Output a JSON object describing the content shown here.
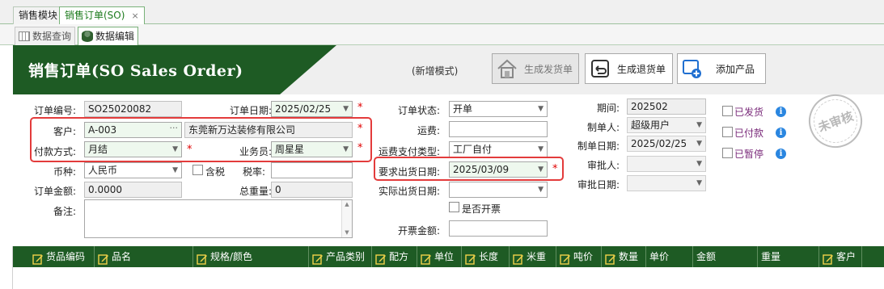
{
  "tabs": [
    {
      "label": "销售模块"
    },
    {
      "label": "销售订单(SO)",
      "close": "×"
    }
  ],
  "subtabs": [
    {
      "label": "数据查询"
    },
    {
      "label": "数据编辑"
    }
  ],
  "header": {
    "title": "销售订单(SO Sales Order)",
    "mode": "(新增模式)",
    "buttons": {
      "generate_shipment": "生成发货单",
      "generate_return": "生成退货单",
      "add_product": "添加产品"
    }
  },
  "form": {
    "order_no": {
      "label": "订单编号:",
      "value": "SO25020082"
    },
    "order_date": {
      "label": "订单日期:",
      "value": "2025/02/25"
    },
    "customer": {
      "label": "客户:",
      "code": "A-003",
      "name": "东莞新万达装修有限公司"
    },
    "payment": {
      "label": "付款方式:",
      "value": "月结"
    },
    "salesman": {
      "label": "业务员:",
      "value": "周星星"
    },
    "currency": {
      "label": "币种:",
      "value": "人民币"
    },
    "tax_included": {
      "label": "含税"
    },
    "tax_rate": {
      "label": "税率:",
      "value": ""
    },
    "order_amount": {
      "label": "订单金额:",
      "value": "0.0000"
    },
    "total_weight": {
      "label": "总重量:",
      "value": "0"
    },
    "remark": {
      "label": "备注:",
      "value": ""
    },
    "order_status": {
      "label": "订单状态:",
      "value": "开单"
    },
    "freight": {
      "label": "运费:",
      "value": ""
    },
    "freight_payment_type": {
      "label": "运费支付类型:",
      "value": "工厂自付"
    },
    "required_ship_date": {
      "label": "要求出货日期:",
      "value": "2025/03/09"
    },
    "actual_ship_date": {
      "label": "实际出货日期:",
      "value": ""
    },
    "invoice": {
      "label": "是否开票"
    },
    "invoice_amount": {
      "label": "开票金额:",
      "value": ""
    },
    "period": {
      "label": "期间:",
      "value": "202502"
    },
    "creator": {
      "label": "制单人:",
      "value": "超级用户"
    },
    "create_date": {
      "label": "制单日期:",
      "value": "2025/02/25"
    },
    "approver": {
      "label": "审批人:",
      "value": ""
    },
    "approve_date": {
      "label": "审批日期:",
      "value": ""
    },
    "flags": [
      {
        "label": "已发货"
      },
      {
        "label": "已付款"
      },
      {
        "label": "已暂停"
      }
    ],
    "stamp": "未审核"
  },
  "table": {
    "columns": [
      {
        "label": "货品编码",
        "editable": true
      },
      {
        "label": "品名",
        "editable": true
      },
      {
        "label": "规格/颜色",
        "editable": true
      },
      {
        "label": "产品类别",
        "editable": true
      },
      {
        "label": "配方",
        "editable": true
      },
      {
        "label": "单位",
        "editable": true
      },
      {
        "label": "长度",
        "editable": true
      },
      {
        "label": "米重",
        "editable": true
      },
      {
        "label": "吨价",
        "editable": true
      },
      {
        "label": "数量",
        "editable": true
      },
      {
        "label": "单价",
        "editable": false
      },
      {
        "label": "金额",
        "editable": false
      },
      {
        "label": "重量",
        "editable": false
      },
      {
        "label": "客户",
        "editable": true
      }
    ]
  },
  "colors": {
    "brand_green": "#1e5b24",
    "required_mark": "#e00000",
    "highlight_box": "#e33b3b",
    "info_icon": "#2a86e0"
  }
}
